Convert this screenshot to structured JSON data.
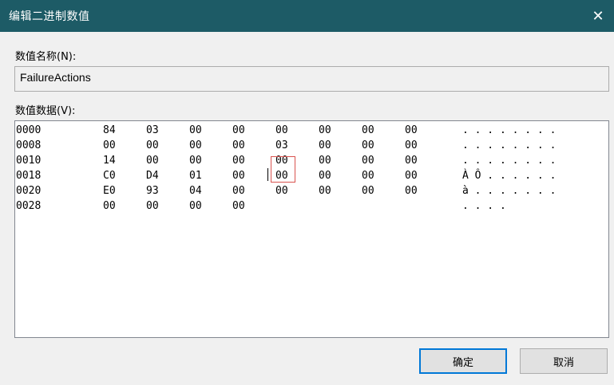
{
  "window": {
    "title": "编辑二进制数值",
    "close_glyph": "✕"
  },
  "value_name": {
    "label": "数值名称(N):",
    "value": "FailureActions"
  },
  "value_data": {
    "label": "数值数据(V):",
    "rows": [
      {
        "offset": "0000",
        "bytes": [
          "84",
          "03",
          "00",
          "00",
          "00",
          "00",
          "00",
          "00"
        ],
        "ascii": ". . . . . . . ."
      },
      {
        "offset": "0008",
        "bytes": [
          "00",
          "00",
          "00",
          "00",
          "03",
          "00",
          "00",
          "00"
        ],
        "ascii": ". . . . . . . ."
      },
      {
        "offset": "0010",
        "bytes": [
          "14",
          "00",
          "00",
          "00",
          "00",
          "00",
          "00",
          "00"
        ],
        "ascii": ". . . . . . . ."
      },
      {
        "offset": "0018",
        "bytes": [
          "C0",
          "D4",
          "01",
          "00",
          "00",
          "00",
          "00",
          "00"
        ],
        "ascii": "À Ô . . . . . ."
      },
      {
        "offset": "0020",
        "bytes": [
          "E0",
          "93",
          "04",
          "00",
          "00",
          "00",
          "00",
          "00"
        ],
        "ascii": "à . . . . . . ."
      },
      {
        "offset": "0028",
        "bytes": [
          "00",
          "00",
          "00",
          "00"
        ],
        "ascii": ". . . ."
      }
    ]
  },
  "buttons": {
    "ok": "确定",
    "cancel": "取消"
  },
  "colors": {
    "titlebar": "#1d5b66",
    "selection_box": "#d9534f",
    "default_button_border": "#0078d7"
  }
}
